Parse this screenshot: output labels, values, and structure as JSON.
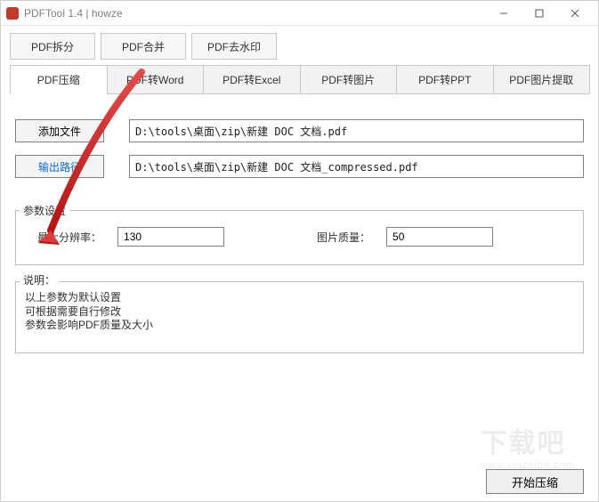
{
  "window": {
    "title": "PDFTool 1.4 | howze"
  },
  "tabs_row1": [
    "PDF拆分",
    "PDF合并",
    "PDF去水印"
  ],
  "tabs_row2": [
    "PDF压缩",
    "PDF转Word",
    "PDF转Excel",
    "PDF转图片",
    "PDF转PPT",
    "PDF图片提取"
  ],
  "active_tab2": 0,
  "buttons": {
    "add_file": "添加文件",
    "output_path": "输出路径",
    "start": "开始压缩"
  },
  "inputs": {
    "file_path": "D:\\tools\\桌面\\zip\\新建 DOC 文档.pdf",
    "output_path": "D:\\tools\\桌面\\zip\\新建 DOC 文档_compressed.pdf"
  },
  "params": {
    "legend": "参数设置",
    "max_res_label": "最大分辨率：",
    "max_res_value": "130",
    "quality_label": "图片质量：",
    "quality_value": "50"
  },
  "desc": {
    "legend": "说明：",
    "line1": "以上参数为默认设置",
    "line2": "可根据需要自行修改",
    "line3": "参数会影响PDF质量及大小"
  },
  "watermark": {
    "main": "下载吧",
    "sub": "www.xiazaiba.com"
  }
}
